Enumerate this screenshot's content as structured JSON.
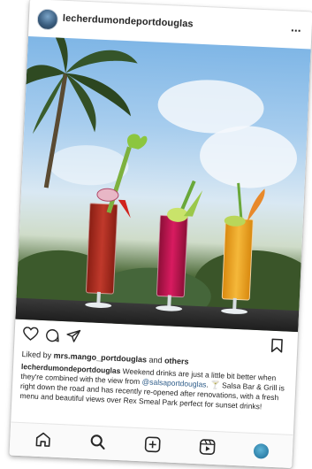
{
  "post": {
    "username": "lecherdumondeportdouglas",
    "more_label": "...",
    "liked_prefix": "Liked by ",
    "liked_user": "mrs.mango_portdouglas",
    "liked_and": " and ",
    "liked_others": "others",
    "caption_user": "lecherdumondeportdouglas",
    "caption_text_1": " Weekend drinks are just a little bit better when they're combined with the view from ",
    "caption_mention": "@salsaportdouglas",
    "caption_text_2": ". 🍸 Salsa Bar & Grill is right down the road and has recently re-opened after renovations, with a fresh menu and beautiful views over Rex Smeal Park perfect for sunset drinks!"
  },
  "icons": {
    "avatar": "avatar",
    "more": "more-icon",
    "like": "heart-icon",
    "comment": "comment-icon",
    "share": "share-icon",
    "save": "bookmark-icon",
    "home": "home-icon",
    "search": "search-icon",
    "new_post": "add-post-icon",
    "reels": "reels-icon",
    "profile": "profile-icon"
  },
  "colors": {
    "text": "#262626",
    "mention": "#2f5d8a",
    "drink_red": "#c0392b",
    "drink_pink": "#d81b60",
    "drink_orange": "#f5a623"
  }
}
